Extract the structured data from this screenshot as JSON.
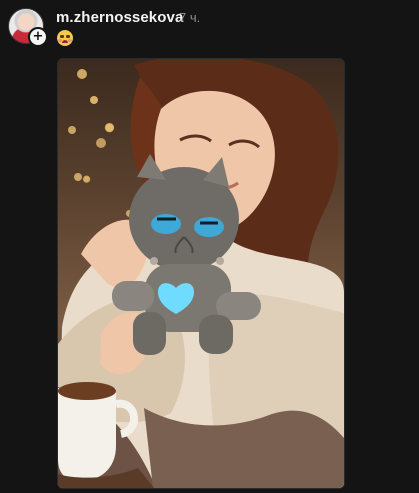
{
  "post": {
    "username": "m.zhernossekova",
    "time": "7 ч."
  },
  "icons": {
    "avatar": "avatar",
    "plus": "+",
    "emoji": "face-holding-back-tears-icon"
  },
  "colors": {
    "background": "#141414",
    "text": "#f2f2f2",
    "secondary_text": "#8d8d8d"
  }
}
